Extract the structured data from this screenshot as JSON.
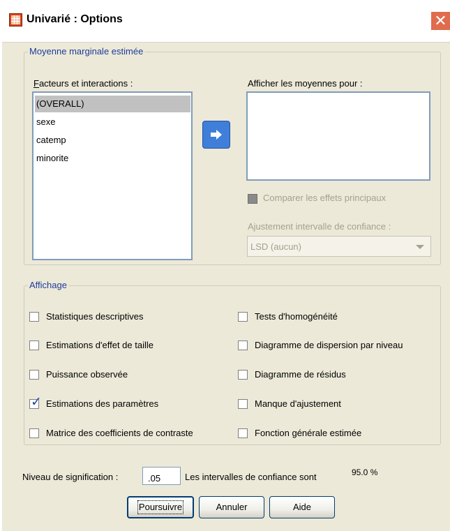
{
  "window": {
    "title": "Univarié : Options",
    "close_glyph": "✕"
  },
  "emm_group": {
    "legend": "Moyenne marginale estimée",
    "factors_label": "Facteurs et interactions :",
    "factors_items": [
      "(OVERALL)",
      "sexe",
      "catemp",
      "minorite"
    ],
    "display_means_label": "Afficher les moyennes pour :",
    "compare_main_label": "Comparer les effets principaux",
    "ci_adjust_label": "Ajustement intervalle de confiance :",
    "ci_adjust_value": "LSD (aucun)"
  },
  "display_group": {
    "legend": "Affichage",
    "left_options": [
      {
        "label": "Statistiques descriptives",
        "checked": false
      },
      {
        "label": "Estimations d'effet de taille",
        "checked": false
      },
      {
        "label": "Puissance observée",
        "checked": false
      },
      {
        "label": "Estimations des paramètres",
        "checked": true
      },
      {
        "label": "Matrice des coefficients de contraste",
        "checked": false
      }
    ],
    "right_options": [
      {
        "label": "Tests d'homogénéité",
        "checked": false
      },
      {
        "label": "Diagramme de dispersion par niveau",
        "checked": false
      },
      {
        "label": "Diagramme de résidus",
        "checked": false
      },
      {
        "label": "Manque d'ajustement",
        "checked": false
      },
      {
        "label": "Fonction générale estimée",
        "checked": false
      }
    ]
  },
  "significance": {
    "label": "Niveau de signification :",
    "value": ".05",
    "ci_text": "Les intervalles de confiance sont",
    "ci_value": "95.0 %"
  },
  "buttons": {
    "continue": "Poursuivre",
    "cancel": "Annuler",
    "help": "Aide"
  }
}
